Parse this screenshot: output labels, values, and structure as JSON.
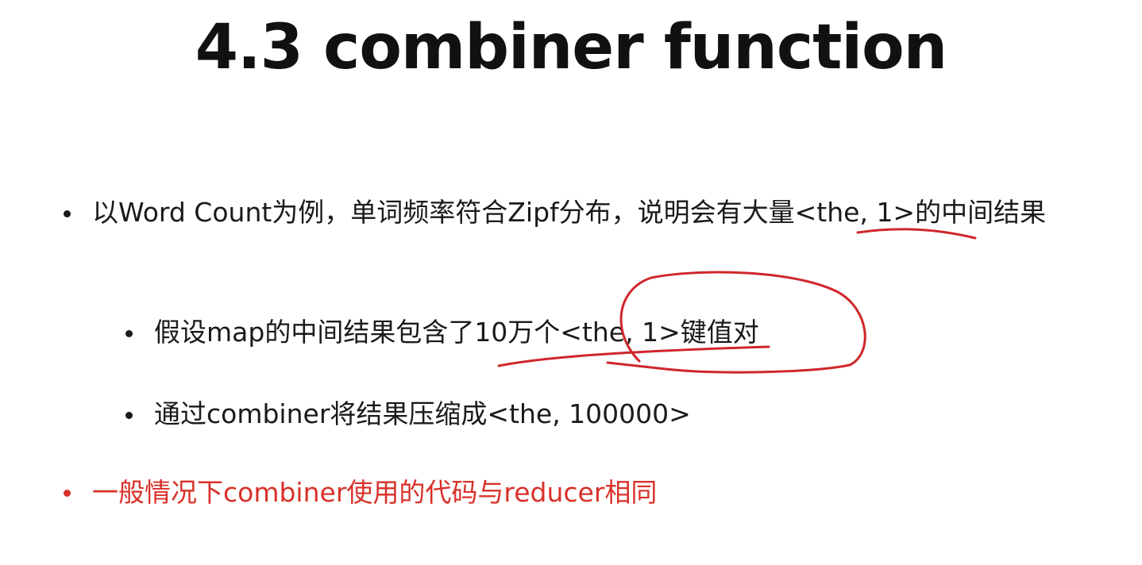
{
  "slide": {
    "title": "4.3 combiner function",
    "bullets": [
      {
        "text": "以Word Count为例，单词频率符合Zipf分布，说明会有大量<the, 1>的中间结果",
        "level": 1,
        "color": "#1a1a1a"
      },
      {
        "text": "假设map的中间结果包含了10万个<the, 1>键值对",
        "level": 2,
        "color": "#1a1a1a"
      },
      {
        "text": "通过combiner将结果压缩成<the, 100000>",
        "level": 2,
        "color": "#1a1a1a"
      },
      {
        "text": "一般情况下combiner使用的代码与reducer相同",
        "level": 1,
        "color": "#d8312a"
      }
    ]
  },
  "colors": {
    "text": "#1a1a1a",
    "accent_red": "#d8312a",
    "annotation_red": "#d0262b",
    "background": "#ffffff"
  }
}
